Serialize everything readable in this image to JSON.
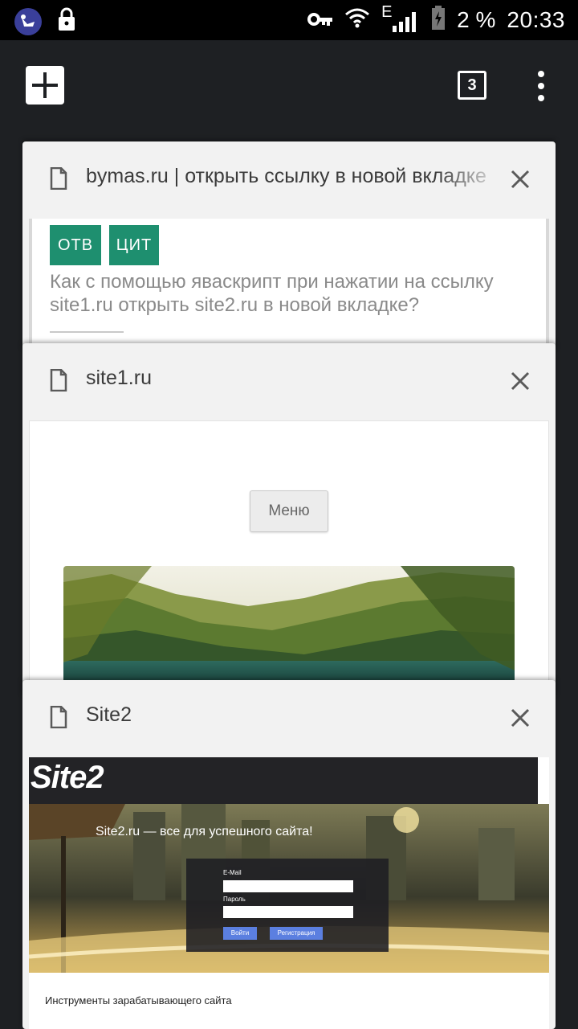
{
  "status_bar": {
    "battery": "2 %",
    "time": "20:33",
    "network": "E"
  },
  "toolbar": {
    "tab_count": "3"
  },
  "tabs": [
    {
      "title": "bymas.ru | открыть ссылку в новой вкладке",
      "preview": {
        "badges": [
          "ОТВ",
          "ЦИТ"
        ],
        "question": "Как с помощью яваскрипт при нажатии на ссылку site1.ru открыть site2.ru в новой вкладке?"
      }
    },
    {
      "title": "site1.ru",
      "preview": {
        "menu_button": "Меню"
      }
    },
    {
      "title": "Site2",
      "preview": {
        "logo": "Site2",
        "tagline": "Site2.ru — все для успешного сайта!",
        "email_label": "E-Mail",
        "password_label": "Пароль",
        "login_button": "Войти",
        "register_button": "Регистрация",
        "footer_text": "Инструменты зарабатывающего сайта"
      }
    }
  ],
  "colors": {
    "background": "#1e2023",
    "badge": "#1e8f6f",
    "site2_button": "#5b7fe0"
  }
}
